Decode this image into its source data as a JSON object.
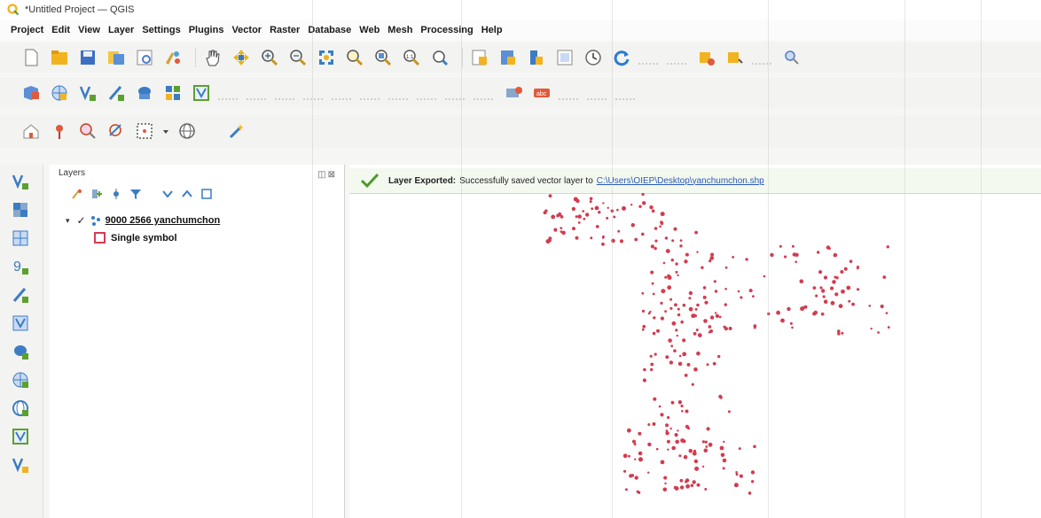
{
  "window": {
    "title": "*Untitled Project — QGIS"
  },
  "menubar": {
    "items": [
      "Project",
      "Edit",
      "View",
      "Layer",
      "Settings",
      "Plugins",
      "Vector",
      "Raster",
      "Database",
      "Web",
      "Mesh",
      "Processing",
      "Help"
    ]
  },
  "toolbars": {
    "file": [
      "new-project-icon",
      "open-project-icon",
      "save-project-icon",
      "layout-manager-icon",
      "layout-icon",
      "style-manager-icon"
    ],
    "navigation": [
      "pan-icon",
      "pan-to-selection-icon",
      "zoom-in-icon",
      "zoom-out-icon",
      "zoom-full-icon",
      "zoom-to-selection-icon",
      "zoom-to-layer-icon",
      "zoom-native-icon",
      "zoom-last-icon"
    ],
    "map": [
      "new-bookmark-icon",
      "show-bookmarks-icon",
      "temporal-controller-icon",
      "refresh-icon"
    ]
  },
  "layers_panel": {
    "title": "Layers",
    "layer": {
      "name": "9000 2566 yanchumchon",
      "checked": true,
      "symbol_label": "Single symbol",
      "symbol_color": "#d23c4f"
    }
  },
  "message_bar": {
    "title": "Layer Exported:",
    "text": "Successfully saved vector layer to",
    "link": "C:\\Users\\OIEP\\Desktop\\yanchumchon.shp",
    "color": "#4c9b2a"
  },
  "map_canvas": {
    "point_color": "#d23c4f"
  }
}
